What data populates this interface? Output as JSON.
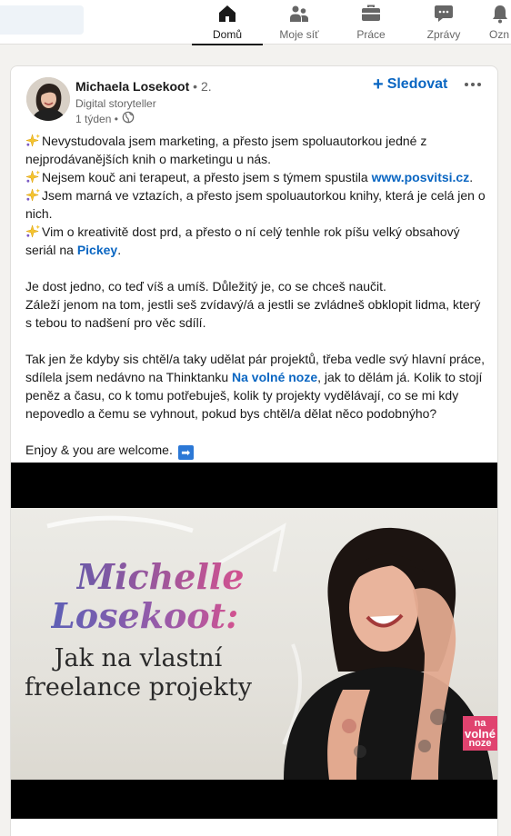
{
  "nav": {
    "items": [
      {
        "label": "Domů",
        "icon": "home-icon",
        "active": true
      },
      {
        "label": "Moje síť",
        "icon": "my-network-icon",
        "active": false
      },
      {
        "label": "Práce",
        "icon": "jobs-briefcase-icon",
        "active": false
      },
      {
        "label": "Zprávy",
        "icon": "messaging-icon",
        "active": false
      },
      {
        "label": "Ozn",
        "icon": "notifications-icon",
        "active": false
      }
    ]
  },
  "post": {
    "author": "Michaela Losekoot",
    "degree": "• 2.",
    "headline": "Digital storyteller",
    "time": "1 týden •",
    "visibility_icon": "globe-icon",
    "follow_label": "Sledovat",
    "more_icon": "more-options-icon",
    "lines": {
      "l1": "Nevystudovala jsem marketing, a přesto jsem spoluautorkou jedné z nejprodávanějších knih o marketingu u nás.",
      "l2_text": "Nejsem kouč ani terapeut, a přesto jsem s týmem spustila ",
      "l2_link": "www.posvitsi.cz",
      "l2_end": ".",
      "l3": "Jsem marná ve vztazích, a přesto jsem spoluautorkou knihy, která je celá jen o nich.",
      "l4_text": "Vim o kreativitě dost prd, a přesto o ní celý tenhle rok píšu velký obsahový seriál na ",
      "l4_link": "Pickey",
      "l4_end": ".",
      "p2a": "Je dost jedno, co teď víš a umíš. Důležitý je, co se chceš naučit.",
      "p2b": "Záleží jenom na tom, jestli seš zvídavý/á a jestli se zvládneš obklopit lidma, který s tebou to nadšení pro věc sdílí.",
      "p3_text1": "Tak jen že kdyby sis chtěl/a taky udělat pár projektů, třeba vedle svý hlavní práce, sdílela jsem nedávno na Thinktanku ",
      "p3_link": "Na volné noze",
      "p3_text2": ", jak to dělám já. Kolik to stojí peněz a času, co k tomu potřebuješ, kolik ty projekty vydělávají, co se mi kdy nepovedlo a čemu se vyhnout, pokud bys chtěl/a dělat něco podobnýho?",
      "p4": "Enjoy & you are welcome."
    },
    "emoji_icon": "sparkles-icon",
    "arrow_icon": "right-arrow-emoji-icon",
    "arrow_glyph": "➡",
    "accent_color": "#0a66c2"
  },
  "media": {
    "title_line1": "Michelle",
    "title_line2": "Losekoot:",
    "subtitle": "Jak na vlastní freelance projekty",
    "badge_top": "na",
    "badge_bottom": "volné",
    "badge_last": "noze",
    "badge_color": "#e0436f"
  }
}
